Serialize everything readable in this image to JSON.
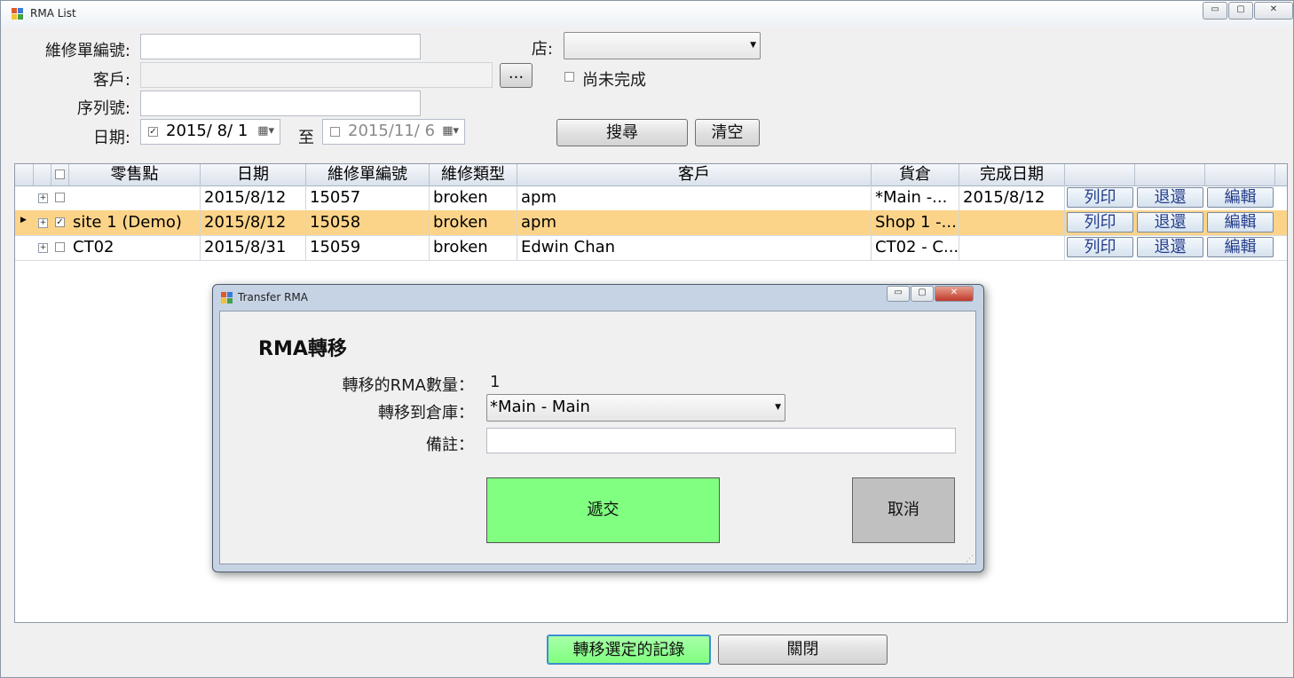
{
  "window": {
    "title": "RMA List",
    "caption_minimize": "▭",
    "caption_maximize": "▢",
    "caption_close": "✕"
  },
  "filters": {
    "rma_no_label": "維修單編號:",
    "rma_no_value": "",
    "store_label": "店:",
    "store_value": "",
    "customer_label": "客戶:",
    "customer_value": "",
    "customer_browse": "...",
    "incomplete_label": "尚未完成",
    "incomplete_checked": false,
    "serial_label": "序列號:",
    "serial_value": "",
    "date_label": "日期:",
    "date_from": "2015/  8/  1",
    "date_from_checked": true,
    "to_label": "至",
    "date_to": "2015/11/  6",
    "date_to_checked": false,
    "search_button": "搜尋",
    "clear_button": "清空"
  },
  "grid": {
    "columns": [
      "零售點",
      "日期",
      "維修單編號",
      "維修類型",
      "客戶",
      "貨倉",
      "完成日期"
    ],
    "rows": [
      {
        "store": "",
        "date": "2015/8/12",
        "rma_no": "15057",
        "type": "broken",
        "customer": "apm",
        "warehouse": "*Main -...",
        "done_date": "2015/8/12",
        "checked": false,
        "selected": false,
        "print": "列印",
        "return": "退還",
        "edit": "編輯"
      },
      {
        "store": "site 1 (Demo)",
        "date": "2015/8/12",
        "rma_no": "15058",
        "type": "broken",
        "customer": "apm",
        "warehouse": "Shop 1 -...",
        "done_date": "",
        "checked": true,
        "selected": true,
        "print": "列印",
        "return": "退還",
        "edit": "編輯"
      },
      {
        "store": "CT02",
        "date": "2015/8/31",
        "rma_no": "15059",
        "type": "broken",
        "customer": "Edwin Chan",
        "warehouse": "CT02 - C...",
        "done_date": "",
        "checked": false,
        "selected": false,
        "print": "列印",
        "return": "退還",
        "edit": "編輯"
      }
    ]
  },
  "footer": {
    "transfer_button": "轉移選定的記錄",
    "close_button": "關閉"
  },
  "dialog": {
    "title": "Transfer RMA",
    "heading": "RMA轉移",
    "count_label": "轉移的RMA數量：",
    "count_value": "1",
    "target_label": "轉移到倉庫：",
    "target_value": "*Main - Main",
    "remark_label": "備註：",
    "remark_value": "",
    "submit_button": "遞交",
    "cancel_button": "取消"
  },
  "colors": {
    "selected_row": "#fbd48a",
    "submit_green": "#80ff80",
    "grid_link_text": "#233d8c"
  }
}
